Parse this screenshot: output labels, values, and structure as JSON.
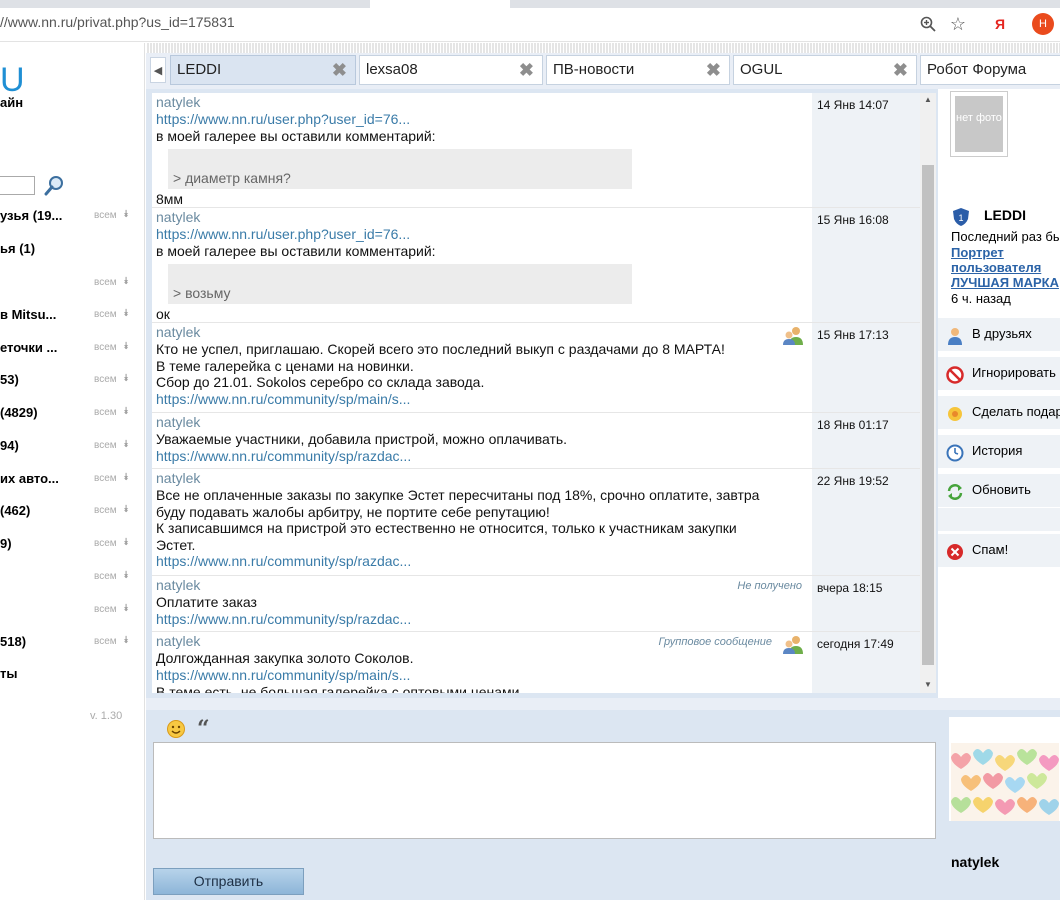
{
  "browser": {
    "url": "//www.nn.ru/privat.php?us_id=175831",
    "yandex_label": "Я",
    "ext_label": "H"
  },
  "sidebar": {
    "logo": "U",
    "logo_sub": "айн",
    "all_label": "всем",
    "items": [
      {
        "label": "узья (19..."
      },
      {
        "label": "ья (1)"
      },
      {
        "label": ""
      },
      {
        "label": "в Mitsu..."
      },
      {
        "label": "еточки ..."
      },
      {
        "label": "53)"
      },
      {
        "label": " (4829)"
      },
      {
        "label": "94)"
      },
      {
        "label": "их авто..."
      },
      {
        "label": " (462)"
      },
      {
        "label": "9)"
      },
      {
        "label": ""
      },
      {
        "label": ""
      },
      {
        "label": "518)"
      },
      {
        "label": "ты"
      }
    ],
    "version": "v. 1.30"
  },
  "tabs": [
    {
      "name": "LEDDI",
      "active": true
    },
    {
      "name": "lexsa08",
      "active": false
    },
    {
      "name": "ПВ-новости",
      "active": false
    },
    {
      "name": "OGUL",
      "active": false
    },
    {
      "name": "Робот Форума",
      "active": false
    }
  ],
  "messages": [
    {
      "author": "natylek",
      "link": "https://www.nn.ru/user.php?user_id=76...",
      "text": "в моей галерее вы оставили комментарий:",
      "quote": "> диаметр камня?",
      "after": "8мм",
      "time": "14 Янв 14:07"
    },
    {
      "author": "natylek",
      "link": "https://www.nn.ru/user.php?user_id=76...",
      "text": "в моей галерее вы оставили комментарий:",
      "quote": "> возьму",
      "after": "ок",
      "time": "15 Янв 16:08"
    },
    {
      "author": "natylek",
      "lines": [
        "Кто не успел, приглашаю. Скорей всего это последний выкуп с раздачами до 8 МАРТА!",
        "В теме галерейка с ценами на новинки.",
        "Сбор до 21.01. Sokolos серебро со склада завода."
      ],
      "link": "https://www.nn.ru/community/sp/main/s...",
      "time": "15 Янв 17:13"
    },
    {
      "author": "natylek",
      "lines": [
        "Уважаемые участники, добавила пристрой, можно оплачивать."
      ],
      "link": "https://www.nn.ru/community/sp/razdac...",
      "time": "18 Янв 01:17"
    },
    {
      "author": "natylek",
      "lines": [
        "Все не оплаченные заказы по закупке Эстет пересчитаны под 18%, срочно оплатите, завтра",
        "буду подавать жалобы арбитру, не портите себе репутацию!",
        "К записавшимся на пристрой это естественно не относится, только к участникам закупки",
        "Эстет."
      ],
      "link": "https://www.nn.ru/community/sp/razdac...",
      "time": "22 Янв 19:52"
    },
    {
      "author": "natylek",
      "status": "Не получено",
      "lines": [
        "Оплатите заказ"
      ],
      "link": "https://www.nn.ru/community/sp/razdac...",
      "time": "вчера 18:15"
    },
    {
      "author": "natylek",
      "status": "Групповое сообщение",
      "lines": [
        "Долгожданная закупка золото Соколов."
      ],
      "link": "https://www.nn.ru/community/sp/main/s...",
      "tail": "В теме есть, не большая галерейка с оптовыми ценами",
      "time": "сегодня 17:49"
    }
  ],
  "profile": {
    "no_photo": "нет фото",
    "name": "LEDDI",
    "last_seen": "Последний раз бы",
    "portrait_lines": [
      "Портрет",
      "пользователя",
      "ЛУЧШАЯ МАРКА"
    ],
    "ago": "6 ч. назад",
    "actions": {
      "friends": "В друзьях",
      "ignore": "Игнорировать",
      "gift": "Сделать подар",
      "history": "История",
      "refresh": "Обновить",
      "spam": "Спам!"
    }
  },
  "composer": {
    "send": "Отправить",
    "sender": "natylek"
  }
}
